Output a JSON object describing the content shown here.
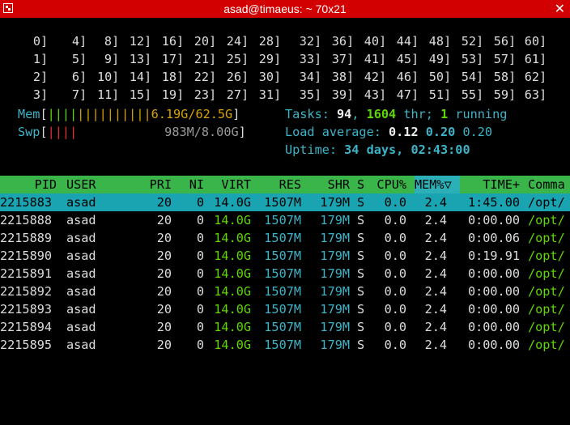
{
  "window": {
    "title": "asad@timaeus: ~ 70x21",
    "close_glyph": "✕",
    "icon": "terminal-icon"
  },
  "cpus": [
    [
      "0",
      "4",
      "8",
      "12",
      "16",
      "20",
      "24",
      "28",
      "32",
      "36",
      "40",
      "44",
      "48",
      "52",
      "56",
      "60"
    ],
    [
      "1",
      "5",
      "9",
      "13",
      "17",
      "21",
      "25",
      "29",
      "33",
      "37",
      "41",
      "45",
      "49",
      "53",
      "57",
      "61"
    ],
    [
      "2",
      "6",
      "10",
      "14",
      "18",
      "22",
      "26",
      "30",
      "34",
      "38",
      "42",
      "46",
      "50",
      "54",
      "58",
      "62"
    ],
    [
      "3",
      "7",
      "11",
      "15",
      "19",
      "23",
      "27",
      "31",
      "35",
      "39",
      "43",
      "47",
      "51",
      "55",
      "59",
      "63"
    ]
  ],
  "mem": {
    "label": "Mem",
    "bar_green": "||||",
    "bar_orange": "||||||||||",
    "value": "6.19G/62.5G"
  },
  "swp": {
    "label": "Swp",
    "bar_red": "||||",
    "value": "983M/8.00G"
  },
  "tasks": {
    "label": "Tasks: ",
    "count": "94",
    "sep": ", ",
    "threads": "1604",
    "thr_label": " thr; ",
    "running": "1",
    "running_label": " running"
  },
  "load": {
    "label": "Load average: ",
    "l1": "0.12",
    "l5": "0.20",
    "l15": "0.20"
  },
  "uptime": {
    "label": "Uptime: ",
    "value": "34 days, 02:43:00"
  },
  "header": {
    "pid": "PID",
    "user": "USER",
    "pri": "PRI",
    "ni": "NI",
    "virt": "VIRT",
    "res": "RES",
    "shr": "SHR",
    "s": "S",
    "cpu": "CPU%",
    "mem": "MEM%▽",
    "time": "TIME+",
    "cmd": "Comma"
  },
  "processes": [
    {
      "pid": "2215883",
      "user": "asad",
      "pri": "20",
      "ni": "0",
      "virt": "14.0G",
      "res": "1507M",
      "shr": "179M",
      "s": "S",
      "cpu": "0.0",
      "mem": "2.4",
      "time": "1:45.00",
      "cmd": "/opt/"
    },
    {
      "pid": "2215888",
      "user": "asad",
      "pri": "20",
      "ni": "0",
      "virt": "14.0G",
      "res": "1507M",
      "shr": "179M",
      "s": "S",
      "cpu": "0.0",
      "mem": "2.4",
      "time": "0:00.00",
      "cmd": "/opt/"
    },
    {
      "pid": "2215889",
      "user": "asad",
      "pri": "20",
      "ni": "0",
      "virt": "14.0G",
      "res": "1507M",
      "shr": "179M",
      "s": "S",
      "cpu": "0.0",
      "mem": "2.4",
      "time": "0:00.06",
      "cmd": "/opt/"
    },
    {
      "pid": "2215890",
      "user": "asad",
      "pri": "20",
      "ni": "0",
      "virt": "14.0G",
      "res": "1507M",
      "shr": "179M",
      "s": "S",
      "cpu": "0.0",
      "mem": "2.4",
      "time": "0:19.91",
      "cmd": "/opt/"
    },
    {
      "pid": "2215891",
      "user": "asad",
      "pri": "20",
      "ni": "0",
      "virt": "14.0G",
      "res": "1507M",
      "shr": "179M",
      "s": "S",
      "cpu": "0.0",
      "mem": "2.4",
      "time": "0:00.00",
      "cmd": "/opt/"
    },
    {
      "pid": "2215892",
      "user": "asad",
      "pri": "20",
      "ni": "0",
      "virt": "14.0G",
      "res": "1507M",
      "shr": "179M",
      "s": "S",
      "cpu": "0.0",
      "mem": "2.4",
      "time": "0:00.00",
      "cmd": "/opt/"
    },
    {
      "pid": "2215893",
      "user": "asad",
      "pri": "20",
      "ni": "0",
      "virt": "14.0G",
      "res": "1507M",
      "shr": "179M",
      "s": "S",
      "cpu": "0.0",
      "mem": "2.4",
      "time": "0:00.00",
      "cmd": "/opt/"
    },
    {
      "pid": "2215894",
      "user": "asad",
      "pri": "20",
      "ni": "0",
      "virt": "14.0G",
      "res": "1507M",
      "shr": "179M",
      "s": "S",
      "cpu": "0.0",
      "mem": "2.4",
      "time": "0:00.00",
      "cmd": "/opt/"
    },
    {
      "pid": "2215895",
      "user": "asad",
      "pri": "20",
      "ni": "0",
      "virt": "14.0G",
      "res": "1507M",
      "shr": "179M",
      "s": "S",
      "cpu": "0.0",
      "mem": "2.4",
      "time": "0:00.00",
      "cmd": "/opt/"
    }
  ]
}
